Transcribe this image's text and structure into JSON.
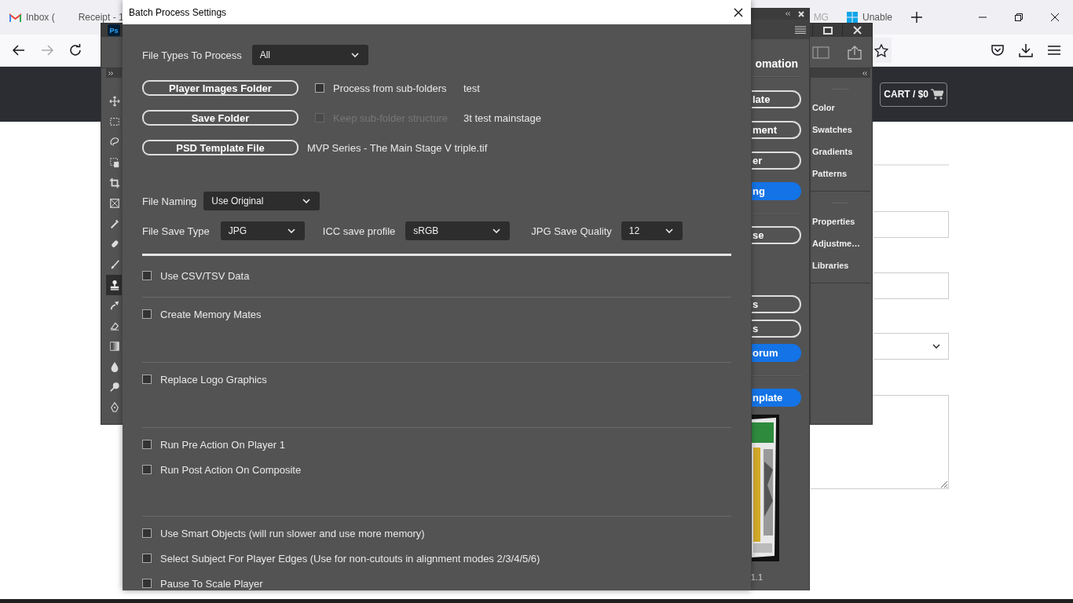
{
  "browser": {
    "tabs": [
      {
        "label": "Inbox (",
        "kind": "mail",
        "selected": false
      },
      {
        "label": "Receipt - 1",
        "kind": "page",
        "selected": false
      },
      {
        "label": "MG",
        "kind": "page",
        "selected": false
      },
      {
        "label": "Unable",
        "kind": "windows",
        "selected": false
      }
    ]
  },
  "site": {
    "cart": "CART / $0"
  },
  "photoshop": {
    "logo": "Ps",
    "tools": [
      {
        "kind": "move",
        "selected": false
      },
      {
        "kind": "marquee",
        "selected": false
      },
      {
        "kind": "lasso",
        "selected": false
      },
      {
        "kind": "select",
        "selected": false
      },
      {
        "kind": "crop",
        "selected": false
      },
      {
        "kind": "frame",
        "selected": false
      },
      {
        "kind": "eyedropper",
        "selected": false
      },
      {
        "kind": "healing",
        "selected": false
      },
      {
        "kind": "brush",
        "selected": false
      },
      {
        "kind": "stamp",
        "selected": true
      },
      {
        "kind": "history",
        "selected": false
      },
      {
        "kind": "eraser",
        "selected": false
      },
      {
        "kind": "gradient",
        "selected": false
      },
      {
        "kind": "blur",
        "selected": false
      },
      {
        "kind": "dodge",
        "selected": false
      },
      {
        "kind": "pen",
        "selected": false
      }
    ],
    "panel_groups": [
      [
        "Color",
        "Swatches",
        "Gradients",
        "Patterns"
      ],
      [
        "Properties",
        "Adjustme…",
        "Libraries"
      ]
    ]
  },
  "automation_panel": {
    "title": "omation",
    "button_groups": [
      [
        {
          "label": "late",
          "kind": "outline"
        },
        {
          "label": "ment",
          "kind": "outline"
        },
        {
          "label": "er",
          "kind": "outline"
        },
        {
          "label": "ng",
          "kind": "primary"
        }
      ],
      [
        {
          "label": "se",
          "kind": "outline"
        }
      ],
      [
        {
          "label": "s",
          "kind": "outline"
        },
        {
          "label": "s",
          "kind": "outline"
        },
        {
          "label": "orum",
          "kind": "primary"
        }
      ],
      [
        {
          "label": "nplate",
          "kind": "primary"
        }
      ]
    ],
    "preview": {
      "kind": "picture"
    },
    "version": "1.1"
  },
  "dialog": {
    "title": "Batch Process Settings",
    "file_types": {
      "label": "File Types To Process",
      "value": "All"
    },
    "paths": [
      {
        "button": "Player Images Folder",
        "option": {
          "label": "Process from sub-folders",
          "checked": false,
          "disabled": false
        },
        "value": "test"
      },
      {
        "button": "Save Folder",
        "option": {
          "label": "Keep sub-folder structure",
          "checked": false,
          "disabled": true
        },
        "value": "3t test mainstage"
      },
      {
        "button": "PSD Template File",
        "value": "MVP Series - The Main Stage V triple.tif"
      }
    ],
    "file_naming": {
      "label": "File Naming",
      "value": "Use Original"
    },
    "save_options": [
      {
        "label": "File Save Type",
        "value": "JPG"
      },
      {
        "label": "ICC save profile",
        "value": "sRGB"
      },
      {
        "label": "JPG Save Quality",
        "value": "12"
      }
    ],
    "sections": [
      {
        "options": [
          {
            "label": "Use CSV/TSV Data",
            "checked": false
          }
        ]
      },
      {
        "options": [
          {
            "label": "Create Memory Mates",
            "checked": false
          }
        ]
      },
      {
        "options": [
          {
            "label": "Replace Logo Graphics",
            "checked": false
          }
        ]
      },
      {
        "options": [
          {
            "label": "Run Pre Action On Player 1",
            "checked": false
          },
          {
            "label": "Run Post Action On Composite",
            "checked": false
          }
        ]
      },
      {
        "options": [
          {
            "label": "Use Smart Objects (will run slower and use more memory)",
            "checked": false
          },
          {
            "label": "Select Subject For Player Edges (Use for non-cutouts in alignment modes 2/3/4/5/6)",
            "checked": false
          },
          {
            "label": "Pause To Scale Player",
            "checked": false
          }
        ]
      }
    ]
  }
}
